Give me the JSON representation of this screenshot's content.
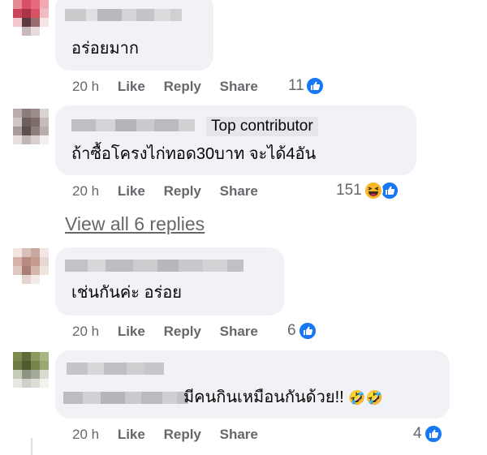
{
  "comments": [
    {
      "text": "อร่อยมาก",
      "time": "20 h",
      "like_label": "Like",
      "reply_label": "Reply",
      "share_label": "Share",
      "reaction_count": "11",
      "reactions": [
        "like-icon"
      ]
    },
    {
      "badge": "Top contributor",
      "text": "ถ้าซื้อโครงไก่ทอด30บาท จะได้4อัน",
      "time": "20 h",
      "like_label": "Like",
      "reply_label": "Reply",
      "share_label": "Share",
      "reaction_count": "151",
      "reactions": [
        "haha-icon",
        "like-icon"
      ]
    },
    {
      "text": "เช่นกันค่ะ อร่อย",
      "time": "20 h",
      "like_label": "Like",
      "reply_label": "Reply",
      "share_label": "Share",
      "reaction_count": "6",
      "reactions": [
        "like-icon"
      ]
    },
    {
      "text": "มีคนกินเหมือนกันด้วย!!",
      "emoji": "🤣🤣",
      "time": "20 h",
      "like_label": "Like",
      "reply_label": "Reply",
      "share_label": "Share",
      "reaction_count": "4",
      "reactions": [
        "like-icon"
      ]
    }
  ],
  "view_all_replies": "View all 6 replies",
  "colors": {
    "bubble": "#f0f2f5",
    "meta": "#65676b",
    "like_blue": "#1877f2",
    "haha_yellow": "#f7b928"
  }
}
